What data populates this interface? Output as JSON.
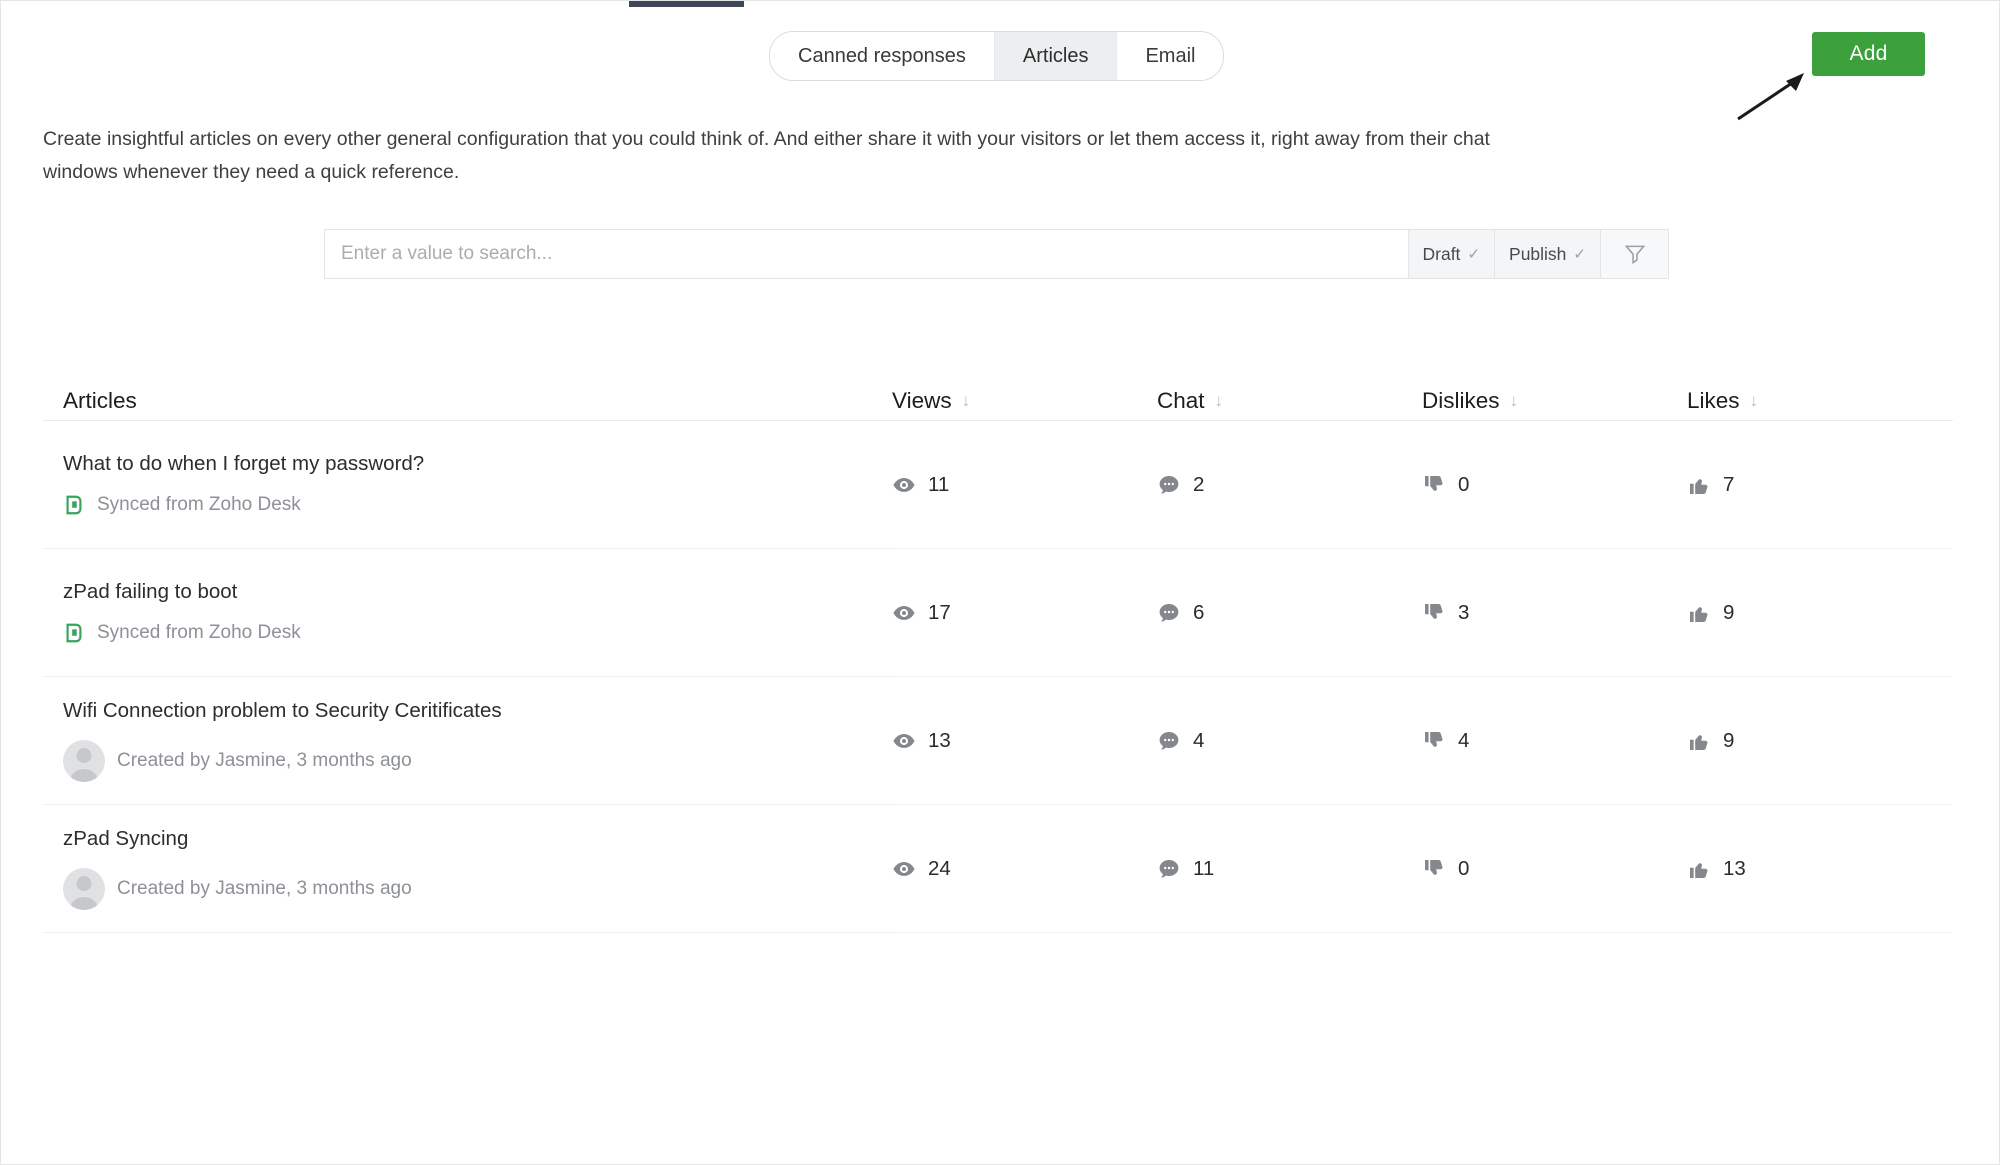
{
  "tabs": [
    {
      "label": "Canned responses",
      "active": false
    },
    {
      "label": "Articles",
      "active": true
    },
    {
      "label": "Email",
      "active": false
    }
  ],
  "toolbar": {
    "add_label": "Add",
    "add_color": "#3ca03d"
  },
  "description": "Create insightful articles on every other general configuration that you could think of. And either share it with your visitors or let them access it, right away from their chat windows whenever they need a quick reference.",
  "search": {
    "placeholder": "Enter a value to search...",
    "value": "",
    "chips": [
      {
        "label": "Draft",
        "tick": "✓"
      },
      {
        "label": "Publish",
        "tick": "✓"
      }
    ],
    "filter_icon": "filter-funnel-icon"
  },
  "table": {
    "headers": [
      {
        "label": "Articles",
        "sort": ""
      },
      {
        "label": "Views",
        "sort": "↓"
      },
      {
        "label": "Chat",
        "sort": "↓"
      },
      {
        "label": "Dislikes",
        "sort": "↓"
      },
      {
        "label": "Likes",
        "sort": "↓"
      }
    ],
    "rows": [
      {
        "title": "What to do when I forget my password?",
        "subtitle": "Synced from Zoho Desk",
        "source_icon": "zoho-desk-icon",
        "views": "11",
        "chat": "2",
        "dislikes": "0",
        "likes": "7"
      },
      {
        "title": "zPad failing to boot",
        "subtitle": "Synced from Zoho Desk",
        "source_icon": "zoho-desk-icon",
        "views": "17",
        "chat": "6",
        "dislikes": "3",
        "likes": "9"
      },
      {
        "title": "Wifi Connection problem to Security Ceritificates",
        "subtitle": "Created by Jasmine, 3 months ago",
        "source_icon": "user-avatar-icon",
        "views": "13",
        "chat": "4",
        "dislikes": "4",
        "likes": "9"
      },
      {
        "title": "zPad Syncing",
        "subtitle": "Created by Jasmine, 3 months ago",
        "source_icon": "user-avatar-icon",
        "views": "24",
        "chat": "11",
        "dislikes": "0",
        "likes": "13"
      }
    ]
  }
}
